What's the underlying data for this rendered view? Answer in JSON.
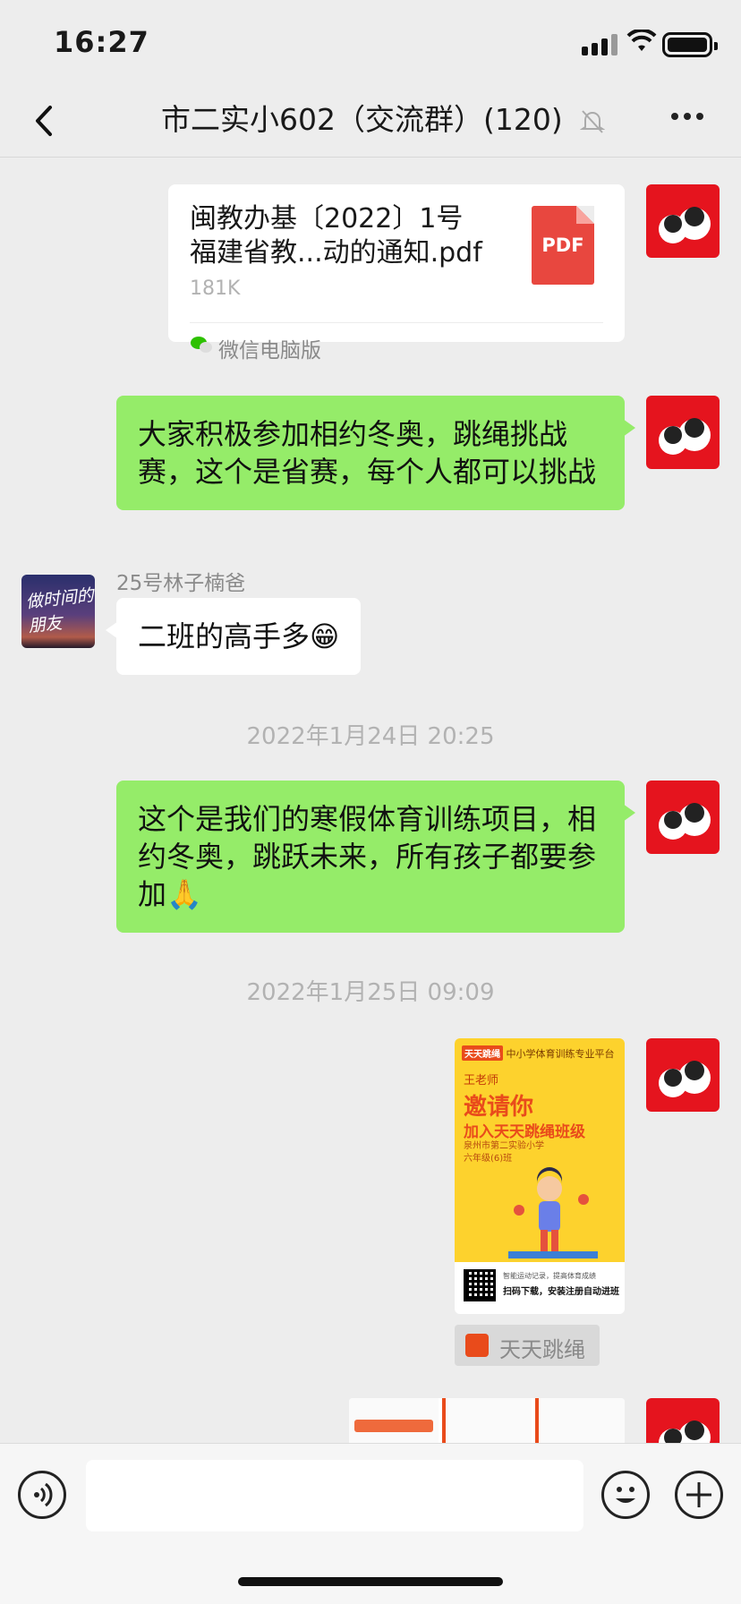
{
  "status_bar": {
    "time": "16:27"
  },
  "header": {
    "back_label": "返回",
    "title": "市二实小602（交流群）(120)"
  },
  "messages": {
    "file": {
      "name_line1": "闽教办基〔2022〕1号",
      "name_line2": "福建省教...动的通知.pdf",
      "size": "181K",
      "source": "微信电脑版",
      "type_label": "PDF"
    },
    "msg1": {
      "text": "大家积极参加相约冬奥，跳绳挑战赛，这个是省赛，每个人都可以挑战"
    },
    "msg2": {
      "sender": "25号林子楠爸",
      "text": "二班的高手多😁",
      "avatar_text": "做时间的朋友"
    },
    "ts1": "2022年1月24日 20:25",
    "msg3": {
      "text": "这个是我们的寒假体育训练项目，相约冬奥，跳跃未来，所有孩子都要参加🙏"
    },
    "ts2": "2022年1月25日 09:09",
    "miniprogram": {
      "brand": "天天跳绳",
      "brand_sub": "中小学体育训练专业平台",
      "teacher": "王老师",
      "headline": "邀请你",
      "subline": "加入天天跳绳班级",
      "school": "泉州市第二实验小学",
      "class": "六年级(6)班",
      "tip1": "智能运动记录，提高体育成绩",
      "tip2": "扫码下载，安装注册自动进班",
      "app_name": "天天跳绳"
    }
  },
  "input": {
    "placeholder": ""
  },
  "colors": {
    "green_bubble": "#95ec69",
    "background": "#ededed",
    "accent": "#e94b1b"
  }
}
